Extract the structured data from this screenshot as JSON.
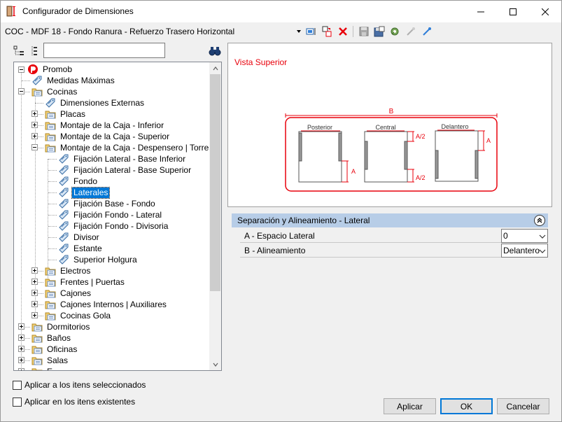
{
  "window": {
    "title": "Configurador de Dimensiones",
    "minimize_icon": "minimize-icon",
    "maximize_icon": "maximize-icon",
    "close_icon": "close-icon"
  },
  "toolbar": {
    "path": "COC - MDF 18 - Fondo Ranura - Refuerzo Trasero Horizontal",
    "icons": [
      "dropdown-arrow-icon",
      "apply-icon",
      "move-icon",
      "delete-icon",
      "save-icon",
      "save-as-icon",
      "settings-icon",
      "link-icon",
      "link-pick-icon"
    ]
  },
  "tree_tools": {
    "icons": [
      "tree-expand-icon",
      "tree-list-icon",
      "binoculars-icon"
    ],
    "search_value": ""
  },
  "tree": {
    "root": "Promob",
    "items": [
      {
        "label": "Medidas Máximas",
        "level": 1,
        "icon": "tag-icon"
      },
      {
        "label": "Cocinas",
        "level": 1,
        "icon": "folder-icon",
        "expander": "minus"
      },
      {
        "label": "Dimensiones Externas",
        "level": 2,
        "icon": "tag-icon"
      },
      {
        "label": "Placas",
        "level": 2,
        "icon": "folder-icon",
        "expander": "plus"
      },
      {
        "label": "Montaje de la Caja - Inferior",
        "level": 2,
        "icon": "folder-icon",
        "expander": "plus"
      },
      {
        "label": "Montaje de la Caja - Superior",
        "level": 2,
        "icon": "folder-icon",
        "expander": "plus"
      },
      {
        "label": "Montaje de la Caja - Despensero | Torres",
        "level": 2,
        "icon": "folder-icon",
        "expander": "minus"
      },
      {
        "label": "Fijación Lateral - Base Inferior",
        "level": 3,
        "icon": "tag-icon"
      },
      {
        "label": "Fijación Lateral - Base Superior",
        "level": 3,
        "icon": "tag-icon"
      },
      {
        "label": "Fondo",
        "level": 3,
        "icon": "tag-icon"
      },
      {
        "label": "Laterales",
        "level": 3,
        "icon": "tag-icon",
        "selected": true
      },
      {
        "label": " Fijación Base - Fondo",
        "level": 3,
        "icon": "tag-icon"
      },
      {
        "label": "Fijación Fondo - Lateral",
        "level": 3,
        "icon": "tag-icon"
      },
      {
        "label": "Fijación Fondo - Divisoria",
        "level": 3,
        "icon": "tag-icon"
      },
      {
        "label": "Divisor",
        "level": 3,
        "icon": "tag-icon"
      },
      {
        "label": "Estante",
        "level": 3,
        "icon": "tag-icon"
      },
      {
        "label": "Superior Holgura",
        "level": 3,
        "icon": "tag-icon"
      },
      {
        "label": "Electros",
        "level": 2,
        "icon": "folder-icon",
        "expander": "plus"
      },
      {
        "label": "Frentes | Puertas",
        "level": 2,
        "icon": "folder-icon",
        "expander": "plus"
      },
      {
        "label": "Cajones",
        "level": 2,
        "icon": "folder-icon",
        "expander": "plus"
      },
      {
        "label": "Cajones Internos | Auxiliares",
        "level": 2,
        "icon": "folder-icon",
        "expander": "plus"
      },
      {
        "label": "Cocinas Gola",
        "level": 2,
        "icon": "folder-icon",
        "expander": "plus"
      },
      {
        "label": "Dormitorios",
        "level": 1,
        "icon": "folder-icon",
        "expander": "plus"
      },
      {
        "label": "Baños",
        "level": 1,
        "icon": "folder-icon",
        "expander": "plus"
      },
      {
        "label": "Oficinas",
        "level": 1,
        "icon": "folder-icon",
        "expander": "plus"
      },
      {
        "label": "Salas",
        "level": 1,
        "icon": "folder-icon",
        "expander": "plus"
      },
      {
        "label": "E",
        "level": 1,
        "icon": "folder-icon",
        "expander": "plus"
      }
    ]
  },
  "preview": {
    "title": "Vista Superior",
    "label_b": "B",
    "label_posterior": "Posterior",
    "label_central": "Central",
    "label_delantero": "Delantero",
    "label_a": "A",
    "label_a2": "A/2",
    "accent": "#e8000b"
  },
  "properties": {
    "header": "Separación y Alineamiento -  Lateral",
    "rows": [
      {
        "name": "A - Espacio Lateral",
        "value": "0"
      },
      {
        "name": "B - Alineamiento",
        "value": "Delantero"
      }
    ]
  },
  "options": {
    "apply_selected": "Aplicar a los itens seleccionados",
    "apply_existing": "Aplicar en los itens existentes"
  },
  "buttons": {
    "apply": "Aplicar",
    "ok": "OK",
    "cancel": "Cancelar"
  }
}
